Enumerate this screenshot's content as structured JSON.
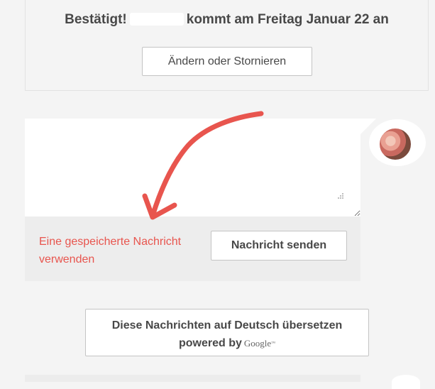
{
  "confirmation": {
    "prefix": "Bestätigt!",
    "suffix": "kommt am Freitag Januar 22 an",
    "change_button": "Ändern oder Stornieren"
  },
  "message": {
    "textarea_value": "",
    "saved_message_link": "Eine gespeicherte Nachricht verwenden",
    "send_button": "Nachricht senden"
  },
  "translate": {
    "line1": "Diese Nachrichten auf Deutsch übersetzen",
    "powered_by": "powered by",
    "google": "Google",
    "tm": "™"
  },
  "colors": {
    "accent_link": "#e8554e",
    "annotation_arrow": "#e8554e"
  },
  "icons": {
    "resize": "resize-grip-icon",
    "avatar": "host-avatar",
    "arrow": "annotation-arrow-icon"
  }
}
